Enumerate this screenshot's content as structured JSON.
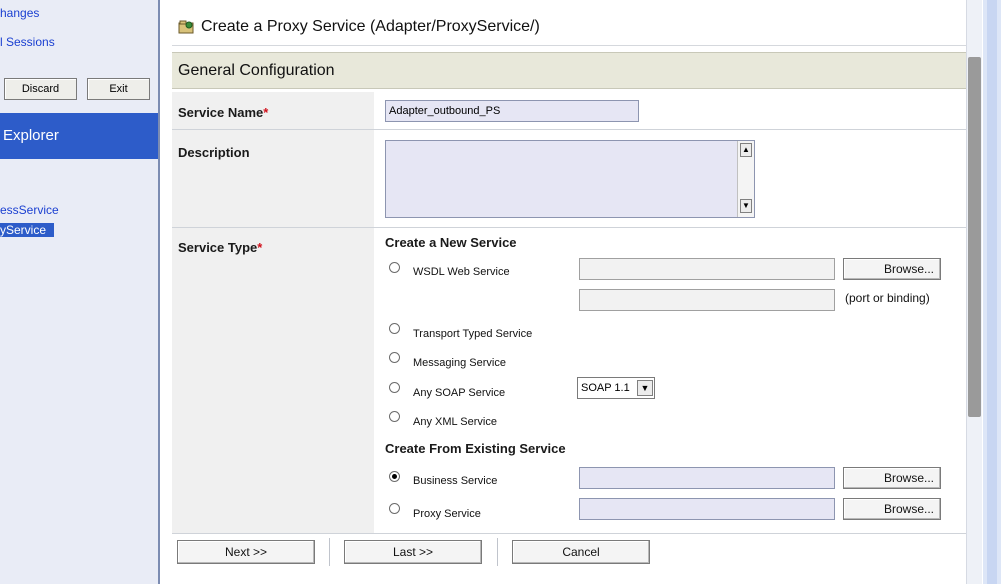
{
  "sidebar": {
    "link_changes": "hanges",
    "link_sessions": "l Sessions",
    "discard_label": "Discard",
    "exit_label": "Exit",
    "explorer_title": "Explorer",
    "tree_items": [
      "essService",
      "yService"
    ]
  },
  "header": {
    "title": "Create a Proxy Service (Adapter/ProxyService/)"
  },
  "section": {
    "title": "General Configuration"
  },
  "form": {
    "service_name_label": "Service Name",
    "service_name_value": "Adapter_outbound_PS",
    "description_label": "Description",
    "service_type_label": "Service Type",
    "required_marker": "*",
    "create_new_heading": "Create a New Service",
    "options_new": [
      {
        "label": "WSDL Web Service",
        "selected": false
      },
      {
        "label": "Transport Typed Service",
        "selected": false
      },
      {
        "label": "Messaging Service",
        "selected": false
      },
      {
        "label": "Any SOAP Service",
        "selected": false
      },
      {
        "label": "Any XML Service",
        "selected": false
      }
    ],
    "port_binding_note": "(port or binding)",
    "browse_label": "Browse...",
    "soap_version": "SOAP 1.1",
    "create_existing_heading": "Create From Existing Service",
    "options_existing": [
      {
        "label": "Business Service",
        "selected": true
      },
      {
        "label": "Proxy Service",
        "selected": false
      }
    ]
  },
  "footer": {
    "next_label": "Next >>",
    "last_label": "Last >>",
    "cancel_label": "Cancel"
  }
}
